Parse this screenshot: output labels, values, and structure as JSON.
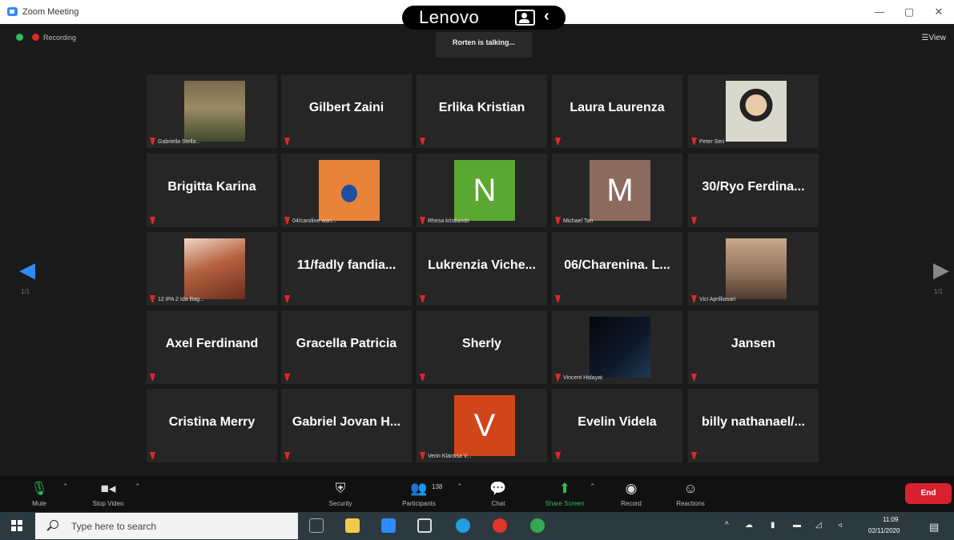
{
  "window": {
    "title": "Zoom Meeting",
    "minimize": "—",
    "maximize": "▢",
    "close": "✕"
  },
  "overlay": {
    "brand": "Lenovo",
    "camera_icon": "camera-privacy-icon",
    "chevron": "‹"
  },
  "meeting": {
    "recording_label": "Recording",
    "talking_text": "Rorten is talking...",
    "view_label": "View",
    "page_left": "1/1",
    "page_right": "1/1"
  },
  "tiles": [
    {
      "name": "",
      "label": "Gabriella Stella...",
      "kind": "photo",
      "photo": "person-standing",
      "muted": true
    },
    {
      "name": "Gilbert Zaini",
      "label": "",
      "kind": "name",
      "muted": true
    },
    {
      "name": "Erlika Kristian",
      "label": "",
      "kind": "name",
      "muted": true
    },
    {
      "name": "Laura Laurenza",
      "label": "",
      "kind": "name",
      "muted": true
    },
    {
      "name": "",
      "label": "Peter Seri",
      "kind": "photo",
      "photo": "person-face",
      "muted": true
    },
    {
      "name": "Brigitta Karina",
      "label": "",
      "kind": "name",
      "muted": true
    },
    {
      "name": "",
      "label": "04/caroline wan...",
      "kind": "photo",
      "photo": "person-orange",
      "muted": true
    },
    {
      "name": "",
      "label": "Rhesa kristiande",
      "kind": "avatar",
      "letter": "N",
      "color": "#5aa732",
      "muted": true
    },
    {
      "name": "",
      "label": "Michael Tan",
      "kind": "avatar",
      "letter": "M",
      "color": "#8c6a5e",
      "muted": true
    },
    {
      "name": "30/Ryo Ferdina...",
      "label": "",
      "kind": "name",
      "muted": true
    },
    {
      "name": "",
      "label": "12 IPA 2 Ida Bag...",
      "kind": "photo",
      "photo": "anime",
      "muted": true
    },
    {
      "name": "11/fadly fandia...",
      "label": "",
      "kind": "name",
      "muted": true
    },
    {
      "name": "Lukrenzia Viche...",
      "label": "",
      "kind": "name",
      "muted": true
    },
    {
      "name": "06/Charenina. L...",
      "label": "",
      "kind": "name",
      "muted": true
    },
    {
      "name": "",
      "label": "Vici Aprilliasari",
      "kind": "photo",
      "photo": "person-room",
      "muted": true
    },
    {
      "name": "Axel Ferdinand",
      "label": "",
      "kind": "name",
      "muted": true
    },
    {
      "name": "Gracella Patricia",
      "label": "",
      "kind": "name",
      "muted": true
    },
    {
      "name": "Sherly",
      "label": "",
      "kind": "name",
      "muted": true
    },
    {
      "name": "",
      "label": "Vincent Hidayat",
      "kind": "photo",
      "photo": "dark",
      "muted": true
    },
    {
      "name": "Jansen",
      "label": "",
      "kind": "name",
      "muted": true
    },
    {
      "name": "Cristina Merry",
      "label": "",
      "kind": "name",
      "muted": true
    },
    {
      "name": "Gabriel Jovan H...",
      "label": "",
      "kind": "name",
      "muted": true
    },
    {
      "name": "",
      "label": "Verin Klarissa V...",
      "kind": "avatar",
      "letter": "V",
      "color": "#d1451b",
      "muted": true
    },
    {
      "name": "Evelin Videla",
      "label": "",
      "kind": "name",
      "muted": true
    },
    {
      "name": "billy nathanael/...",
      "label": "",
      "kind": "name",
      "muted": true
    }
  ],
  "toolbar": {
    "mute": "Mute",
    "stop_video": "Stop Video",
    "security": "Security",
    "participants": "Participants",
    "participant_count": "138",
    "chat": "Chat",
    "share_screen": "Share Screen",
    "record": "Record",
    "reactions": "Reactions",
    "end": "End"
  },
  "taskbar": {
    "search_placeholder": "Type here to search",
    "time": "11:09",
    "date": "02/11/2020"
  },
  "colors": {
    "accent": "#2d8cff",
    "share_green": "#2ebd59",
    "end_red": "#d9202f",
    "mute_red": "#e02828"
  }
}
